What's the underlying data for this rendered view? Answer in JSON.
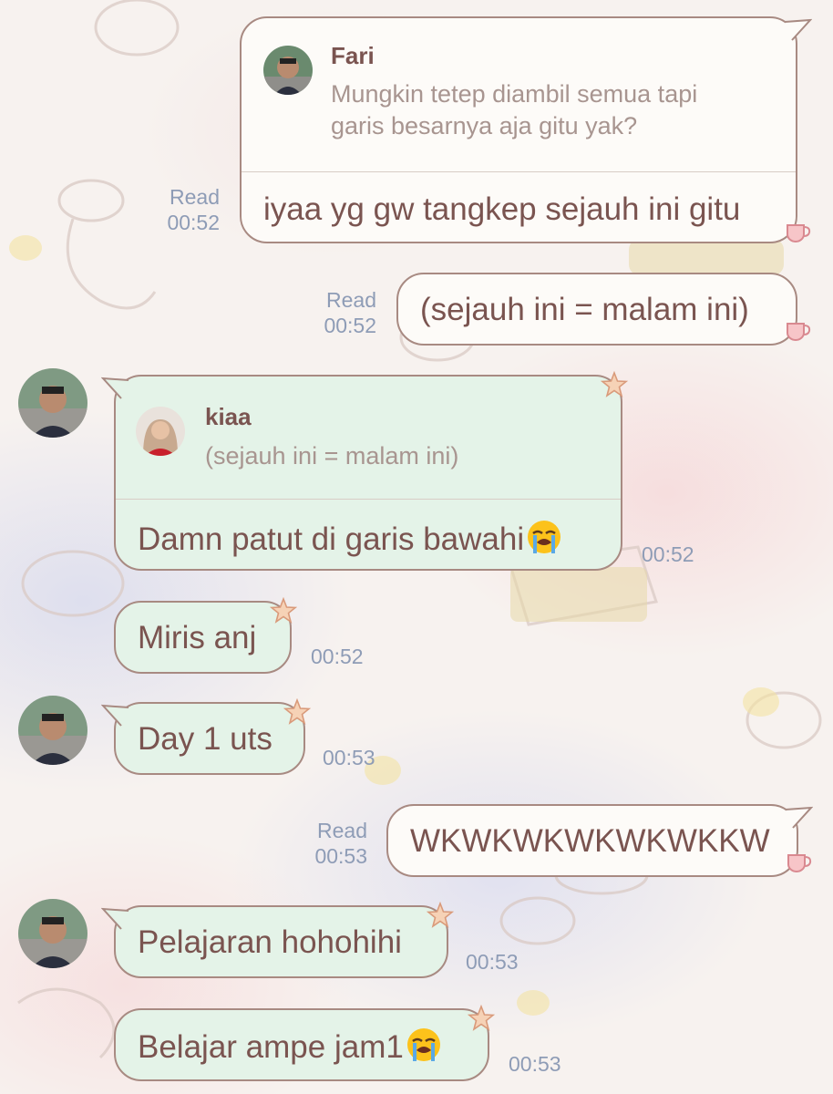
{
  "messages": [
    {
      "direction": "outgoing",
      "reply_to": {
        "name": "Fari",
        "text_line1": "Mungkin tetep diambil semua tapi",
        "text_line2": "garis besarnya aja gitu yak?"
      },
      "text": "iyaa yg gw tangkep sejauh ini gitu",
      "status": "Read",
      "time": "00:52"
    },
    {
      "direction": "outgoing",
      "text": "(sejauh ini = malam ini)",
      "status": "Read",
      "time": "00:52"
    },
    {
      "direction": "incoming",
      "reply_to": {
        "name": "kiaa",
        "text": "(sejauh ini = malam ini)"
      },
      "text": "Damn patut di garis bawahi",
      "emoji": "loudly-crying-face",
      "time": "00:52"
    },
    {
      "direction": "incoming",
      "text": "Miris anj",
      "time": "00:52"
    },
    {
      "direction": "incoming",
      "text": "Day 1 uts",
      "time": "00:53"
    },
    {
      "direction": "outgoing",
      "text": "WKWKWKWKWKWKKW",
      "status": "Read",
      "time": "00:53"
    },
    {
      "direction": "incoming",
      "text": "Pelajaran hohohihi",
      "time": "00:53"
    },
    {
      "direction": "incoming",
      "text": "Belajar ampe jam1",
      "emoji": "loudly-crying-face",
      "time": "00:53"
    }
  ],
  "colors": {
    "text": "#7a5450",
    "meta": "#8e9cb6",
    "incoming_bubble": "#e4f3e8",
    "outgoing_bubble": "#fdfbf8",
    "bubble_border": "#a88a82"
  }
}
